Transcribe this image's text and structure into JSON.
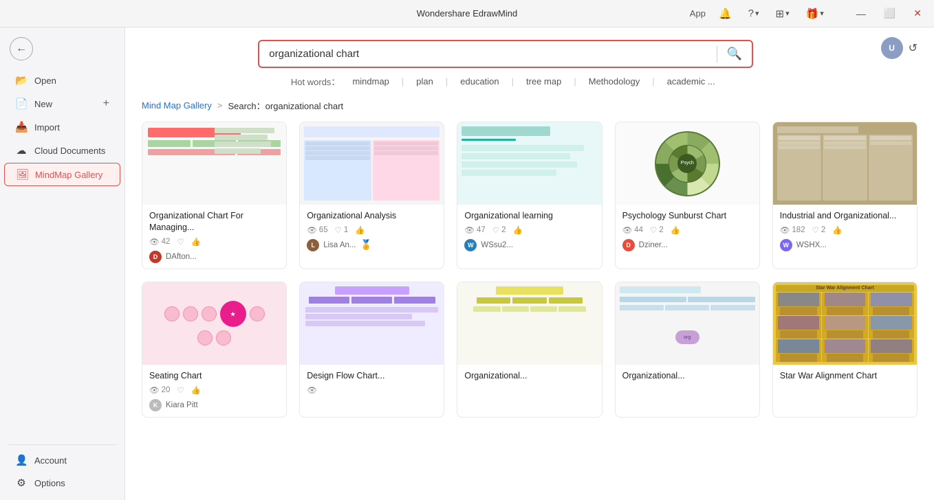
{
  "app": {
    "title": "Wondershare EdrawMind",
    "window_controls": [
      "minimize",
      "maximize",
      "close"
    ]
  },
  "titlebar": {
    "title": "Wondershare EdrawMind",
    "app_label": "App",
    "minimize": "—",
    "maximize": "⬜",
    "close": "✕"
  },
  "sidebar": {
    "back_icon": "←",
    "items": [
      {
        "id": "open",
        "label": "Open",
        "icon": "📂"
      },
      {
        "id": "new",
        "label": "New",
        "icon": "📄",
        "has_plus": true
      },
      {
        "id": "import",
        "label": "Import",
        "icon": "📥"
      },
      {
        "id": "cloud",
        "label": "Cloud Documents",
        "icon": "☁"
      },
      {
        "id": "mindmap-gallery",
        "label": "MindMap Gallery",
        "icon": "🖼",
        "active": true
      }
    ],
    "bottom_items": [
      {
        "id": "account",
        "label": "Account",
        "icon": "👤"
      },
      {
        "id": "options",
        "label": "Options",
        "icon": "⚙"
      }
    ]
  },
  "search": {
    "placeholder": "organizational chart",
    "value": "organizational chart",
    "search_icon": "🔍",
    "hot_words_label": "Hot words：",
    "hot_words": [
      "mindmap",
      "plan",
      "education",
      "tree map",
      "Methodology",
      "academic ..."
    ]
  },
  "breadcrumb": {
    "gallery_label": "Mind Map Gallery",
    "arrow": ">",
    "search_prefix": "Search：",
    "search_term": "organizational chart"
  },
  "gallery": {
    "cards": [
      {
        "id": "card1",
        "title": "Organizational Chart For Managing...",
        "views": "42",
        "likes": "",
        "hearts": "",
        "author": "DAfton...",
        "author_color": "#c0392b",
        "thumb_type": "org1",
        "row": 1
      },
      {
        "id": "card2",
        "title": "Organizational Analysis",
        "views": "65",
        "likes": "1",
        "hearts": "",
        "author": "Lisa An...",
        "author_color": "#8b5e3c",
        "has_badge": true,
        "thumb_type": "analysis",
        "row": 1
      },
      {
        "id": "card3",
        "title": "Organizational learning",
        "views": "47",
        "likes": "2",
        "hearts": "",
        "author": "WSsu2...",
        "author_color": "#2980b9",
        "thumb_type": "learning",
        "row": 1
      },
      {
        "id": "card4",
        "title": "Psychology Sunburst Chart",
        "views": "44",
        "likes": "2",
        "hearts": "",
        "author": "Dziner...",
        "author_color": "#e74c3c",
        "thumb_type": "sunburst",
        "row": 1
      },
      {
        "id": "card5",
        "title": "Industrial and Organizational...",
        "views": "182",
        "likes": "2",
        "hearts": "",
        "author": "WSHX...",
        "author_color": "#7b68ee",
        "thumb_type": "industrial",
        "row": 1
      },
      {
        "id": "card6",
        "title": "Seating Chart",
        "views": "20",
        "likes": "",
        "hearts": "",
        "author": "Kiara Pitt",
        "author_color": "#aaa",
        "thumb_type": "seating",
        "row": 2
      },
      {
        "id": "card7",
        "title": "Design Flow Chart...",
        "views": "",
        "likes": "",
        "hearts": "",
        "author": "",
        "author_color": "#aaa",
        "thumb_type": "design",
        "row": 2
      },
      {
        "id": "card8",
        "title": "Organizational...",
        "views": "",
        "likes": "",
        "hearts": "",
        "author": "",
        "author_color": "#aaa",
        "thumb_type": "org2",
        "row": 2
      },
      {
        "id": "card9",
        "title": "",
        "views": "",
        "likes": "",
        "hearts": "",
        "author": "",
        "author_color": "#aaa",
        "thumb_type": "blank",
        "row": 2
      },
      {
        "id": "card10",
        "title": "Star War Alignment Chart",
        "views": "",
        "likes": "",
        "hearts": "",
        "author": "",
        "author_color": "#aaa",
        "thumb_type": "starwars",
        "row": 2
      }
    ]
  },
  "icons": {
    "back": "←",
    "eye": "👁",
    "heart": "♡",
    "like": "👍",
    "search": "🔍",
    "plus": "+",
    "bell": "🔔",
    "help": "?",
    "grid": "⊞",
    "gift": "🎁",
    "refresh": "↺",
    "user_circle": "👤"
  }
}
